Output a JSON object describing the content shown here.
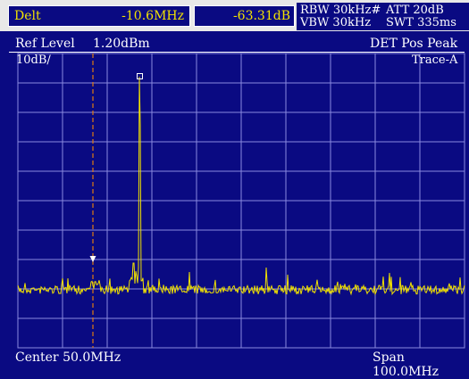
{
  "marker_box": {
    "label": "Delt",
    "value": "-10.6MHz"
  },
  "level_box": {
    "value": "-63.31dB"
  },
  "settings": {
    "rbw": "RBW 30kHz#",
    "att": "ATT 20dB",
    "vbw": "VBW 30kHz",
    "swt": "SWT 335ms"
  },
  "header": {
    "ref_level_label": "Ref Level",
    "ref_level_value": "1.20dBm",
    "detector": "DET  Pos Peak",
    "scale": "10dB/",
    "trace": "Trace-A"
  },
  "footer": {
    "center": "Center 50.0MHz",
    "span": "Span 100.0MHz"
  },
  "colors": {
    "background": "#0a0a82",
    "grid": "#8a8ae0",
    "trace": "#f2e200",
    "marker_line": "#e07a10",
    "readout": "#f2e200"
  }
}
